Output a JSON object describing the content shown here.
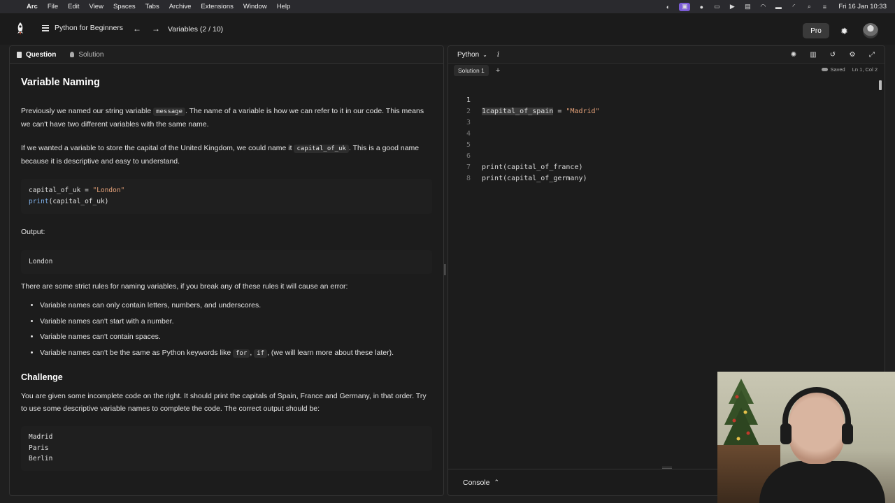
{
  "menubar": {
    "app": "Arc",
    "items": [
      "File",
      "Edit",
      "View",
      "Spaces",
      "Tabs",
      "Archive",
      "Extensions",
      "Window",
      "Help"
    ],
    "clock": "Fri 16 Jan  10:33"
  },
  "header": {
    "course": "Python for Beginners",
    "lesson": "Variables (2 / 10)",
    "pro_label": "Pro"
  },
  "left": {
    "tabs": {
      "question": "Question",
      "solution": "Solution"
    },
    "title": "Variable Naming",
    "p1_a": "Previously we named our string variable ",
    "p1_code": "message",
    "p1_b": ". The name of a variable is how we can refer to it in our code. This means we can't have two different variables with the same name.",
    "p2_a": "If we wanted a variable to store the capital of the United Kingdom, we could name it ",
    "p2_code": "capital_of_uk",
    "p2_b": ". This is a good name because it is descriptive and easy to understand.",
    "example_code": {
      "line1_var": "capital_of_uk = ",
      "line1_str": "\"London\"",
      "line2_fn": "print",
      "line2_rest": "(capital_of_uk)"
    },
    "output_label": "Output:",
    "output_value": "London",
    "rules_intro": "There are some strict rules for naming variables, if you break any of these rules it will cause an error:",
    "rules": [
      "Variable names can only contain letters, numbers, and underscores.",
      "Variable names can't start with a number.",
      "Variable names can't contain spaces."
    ],
    "rule4_a": "Variable names can't be the same as Python keywords like ",
    "rule4_code1": "for",
    "rule4_sep": ", ",
    "rule4_code2": "if",
    "rule4_b": ", (we will learn more about these later).",
    "challenge_title": "Challenge",
    "challenge_text": "You are given some incomplete code on the right. It should print the capitals of Spain, France and Germany, in that order. Try to use some descriptive variable names to complete the code. The correct output should be:",
    "expected_output": [
      "Madrid",
      "Paris",
      "Berlin"
    ]
  },
  "editor": {
    "language": "Python",
    "info_label": "i",
    "file_tab": "Solution 1",
    "add_tab": "+",
    "saved": "Saved",
    "cursor": "Ln 1, Col 2",
    "line_numbers": [
      "1",
      "2",
      "3",
      "4",
      "5",
      "6",
      "7",
      "8"
    ],
    "lines": [
      "1capital_of_spain = \"Madrid\"",
      "",
      "",
      "",
      "",
      "print(capital_of_france)",
      "print(capital_of_germany)",
      ""
    ],
    "console_label": "Console"
  },
  "colors": {
    "background": "#1f1f1f",
    "string": "#e7a37a",
    "function": "#7fb0e8",
    "accent_tray": "#7b5cd6"
  }
}
